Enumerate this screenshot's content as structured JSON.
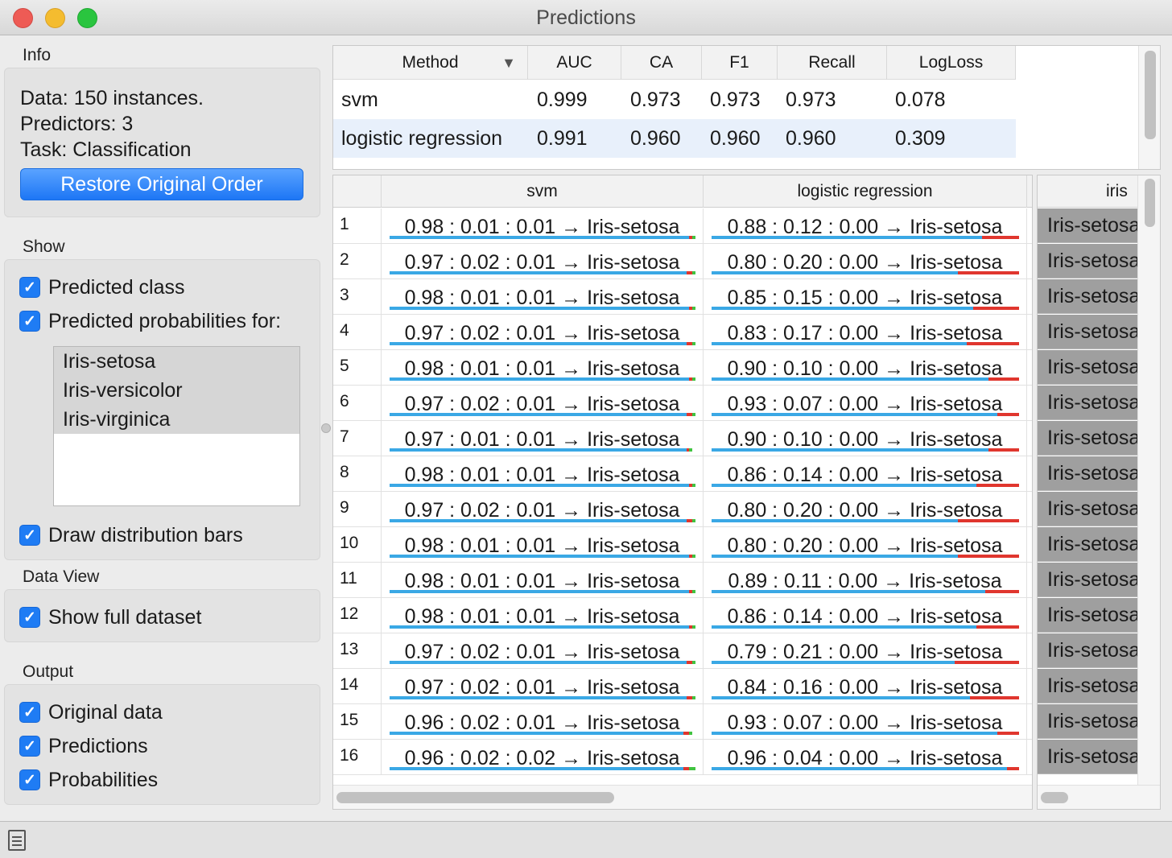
{
  "window": {
    "title": "Predictions"
  },
  "info": {
    "label": "Info",
    "data_line": "Data: 150 instances.",
    "predictors_line": "Predictors: 3",
    "task_line": "Task: Classification",
    "restore_button": "Restore Original Order"
  },
  "show": {
    "label": "Show",
    "predicted_class": "Predicted class",
    "predicted_probs": "Predicted probabilities for:",
    "classes": [
      "Iris-setosa",
      "Iris-versicolor",
      "Iris-virginica"
    ],
    "draw_bars": "Draw distribution bars"
  },
  "data_view": {
    "label": "Data View",
    "show_full": "Show full dataset"
  },
  "output": {
    "label": "Output",
    "original_data": "Original data",
    "predictions": "Predictions",
    "probabilities": "Probabilities"
  },
  "scores": {
    "headers": [
      "Method",
      "AUC",
      "CA",
      "F1",
      "Recall",
      "LogLoss"
    ],
    "rows": [
      [
        "svm",
        "0.999",
        "0.973",
        "0.973",
        "0.973",
        "0.078"
      ],
      [
        "logistic regression",
        "0.991",
        "0.960",
        "0.960",
        "0.960",
        "0.309"
      ]
    ]
  },
  "predictions": {
    "headers": [
      "svm",
      "logistic regression"
    ],
    "rows": [
      [
        "1",
        "0.98 : 0.01 : 0.01 → Iris-setosa",
        "0.88 : 0.12 : 0.00 → Iris-setosa"
      ],
      [
        "2",
        "0.97 : 0.02 : 0.01 → Iris-setosa",
        "0.80 : 0.20 : 0.00 → Iris-setosa"
      ],
      [
        "3",
        "0.98 : 0.01 : 0.01 → Iris-setosa",
        "0.85 : 0.15 : 0.00 → Iris-setosa"
      ],
      [
        "4",
        "0.97 : 0.02 : 0.01 → Iris-setosa",
        "0.83 : 0.17 : 0.00 → Iris-setosa"
      ],
      [
        "5",
        "0.98 : 0.01 : 0.01 → Iris-setosa",
        "0.90 : 0.10 : 0.00 → Iris-setosa"
      ],
      [
        "6",
        "0.97 : 0.02 : 0.01 → Iris-setosa",
        "0.93 : 0.07 : 0.00 → Iris-setosa"
      ],
      [
        "7",
        "0.97 : 0.01 : 0.01 → Iris-setosa",
        "0.90 : 0.10 : 0.00 → Iris-setosa"
      ],
      [
        "8",
        "0.98 : 0.01 : 0.01 → Iris-setosa",
        "0.86 : 0.14 : 0.00 → Iris-setosa"
      ],
      [
        "9",
        "0.97 : 0.02 : 0.01 → Iris-setosa",
        "0.80 : 0.20 : 0.00 → Iris-setosa"
      ],
      [
        "10",
        "0.98 : 0.01 : 0.01 → Iris-setosa",
        "0.80 : 0.20 : 0.00 → Iris-setosa"
      ],
      [
        "11",
        "0.98 : 0.01 : 0.01 → Iris-setosa",
        "0.89 : 0.11 : 0.00 → Iris-setosa"
      ],
      [
        "12",
        "0.98 : 0.01 : 0.01 → Iris-setosa",
        "0.86 : 0.14 : 0.00 → Iris-setosa"
      ],
      [
        "13",
        "0.97 : 0.02 : 0.01 → Iris-setosa",
        "0.79 : 0.21 : 0.00 → Iris-setosa"
      ],
      [
        "14",
        "0.97 : 0.02 : 0.01 → Iris-setosa",
        "0.84 : 0.16 : 0.00 → Iris-setosa"
      ],
      [
        "15",
        "0.96 : 0.02 : 0.01 → Iris-setosa",
        "0.93 : 0.07 : 0.00 → Iris-setosa"
      ],
      [
        "16",
        "0.96 : 0.02 : 0.02 → Iris-setosa",
        "0.96 : 0.04 : 0.00 → Iris-setosa"
      ]
    ]
  },
  "iris": {
    "header": "iris",
    "value": "Iris-setosa"
  },
  "colors": {
    "accent": "#1f7cf4",
    "bar_setosa": "#3aa8e5",
    "bar_versicolor": "#e0362e",
    "bar_virginica": "#40c340",
    "selected_row": "#e8f0fb"
  },
  "icons": {
    "status": "document-icon",
    "sort": "sort-down-icon"
  }
}
